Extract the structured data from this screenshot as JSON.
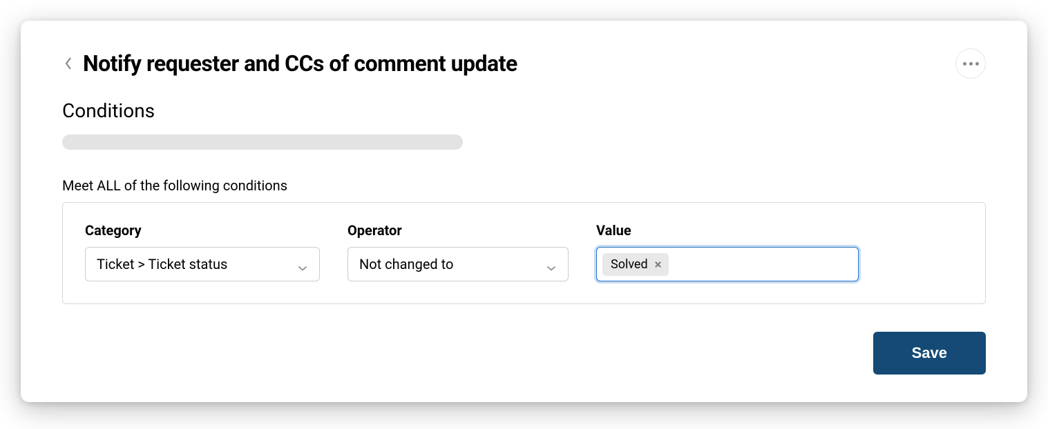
{
  "header": {
    "title": "Notify requester and CCs of comment update"
  },
  "section": {
    "title": "Conditions",
    "meet_all_label": "Meet ALL of the following conditions"
  },
  "condition": {
    "category_label": "Category",
    "category_value": "Ticket > Ticket status",
    "operator_label": "Operator",
    "operator_value": "Not changed to",
    "value_label": "Value",
    "value_tag": "Solved"
  },
  "footer": {
    "save_label": "Save"
  }
}
